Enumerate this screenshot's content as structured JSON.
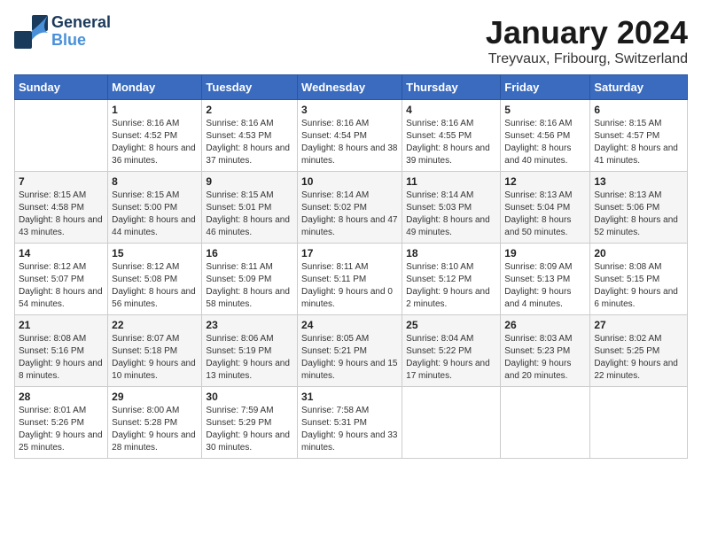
{
  "logo": {
    "general": "General",
    "blue": "Blue",
    "bird_unicode": "🐦"
  },
  "header": {
    "month_year": "January 2024",
    "location": "Treyvaux, Fribourg, Switzerland"
  },
  "weekdays": [
    "Sunday",
    "Monday",
    "Tuesday",
    "Wednesday",
    "Thursday",
    "Friday",
    "Saturday"
  ],
  "weeks": [
    [
      {
        "day": "",
        "sunrise": "",
        "sunset": "",
        "daylight": ""
      },
      {
        "day": "1",
        "sunrise": "Sunrise: 8:16 AM",
        "sunset": "Sunset: 4:52 PM",
        "daylight": "Daylight: 8 hours and 36 minutes."
      },
      {
        "day": "2",
        "sunrise": "Sunrise: 8:16 AM",
        "sunset": "Sunset: 4:53 PM",
        "daylight": "Daylight: 8 hours and 37 minutes."
      },
      {
        "day": "3",
        "sunrise": "Sunrise: 8:16 AM",
        "sunset": "Sunset: 4:54 PM",
        "daylight": "Daylight: 8 hours and 38 minutes."
      },
      {
        "day": "4",
        "sunrise": "Sunrise: 8:16 AM",
        "sunset": "Sunset: 4:55 PM",
        "daylight": "Daylight: 8 hours and 39 minutes."
      },
      {
        "day": "5",
        "sunrise": "Sunrise: 8:16 AM",
        "sunset": "Sunset: 4:56 PM",
        "daylight": "Daylight: 8 hours and 40 minutes."
      },
      {
        "day": "6",
        "sunrise": "Sunrise: 8:15 AM",
        "sunset": "Sunset: 4:57 PM",
        "daylight": "Daylight: 8 hours and 41 minutes."
      }
    ],
    [
      {
        "day": "7",
        "sunrise": "Sunrise: 8:15 AM",
        "sunset": "Sunset: 4:58 PM",
        "daylight": "Daylight: 8 hours and 43 minutes."
      },
      {
        "day": "8",
        "sunrise": "Sunrise: 8:15 AM",
        "sunset": "Sunset: 5:00 PM",
        "daylight": "Daylight: 8 hours and 44 minutes."
      },
      {
        "day": "9",
        "sunrise": "Sunrise: 8:15 AM",
        "sunset": "Sunset: 5:01 PM",
        "daylight": "Daylight: 8 hours and 46 minutes."
      },
      {
        "day": "10",
        "sunrise": "Sunrise: 8:14 AM",
        "sunset": "Sunset: 5:02 PM",
        "daylight": "Daylight: 8 hours and 47 minutes."
      },
      {
        "day": "11",
        "sunrise": "Sunrise: 8:14 AM",
        "sunset": "Sunset: 5:03 PM",
        "daylight": "Daylight: 8 hours and 49 minutes."
      },
      {
        "day": "12",
        "sunrise": "Sunrise: 8:13 AM",
        "sunset": "Sunset: 5:04 PM",
        "daylight": "Daylight: 8 hours and 50 minutes."
      },
      {
        "day": "13",
        "sunrise": "Sunrise: 8:13 AM",
        "sunset": "Sunset: 5:06 PM",
        "daylight": "Daylight: 8 hours and 52 minutes."
      }
    ],
    [
      {
        "day": "14",
        "sunrise": "Sunrise: 8:12 AM",
        "sunset": "Sunset: 5:07 PM",
        "daylight": "Daylight: 8 hours and 54 minutes."
      },
      {
        "day": "15",
        "sunrise": "Sunrise: 8:12 AM",
        "sunset": "Sunset: 5:08 PM",
        "daylight": "Daylight: 8 hours and 56 minutes."
      },
      {
        "day": "16",
        "sunrise": "Sunrise: 8:11 AM",
        "sunset": "Sunset: 5:09 PM",
        "daylight": "Daylight: 8 hours and 58 minutes."
      },
      {
        "day": "17",
        "sunrise": "Sunrise: 8:11 AM",
        "sunset": "Sunset: 5:11 PM",
        "daylight": "Daylight: 9 hours and 0 minutes."
      },
      {
        "day": "18",
        "sunrise": "Sunrise: 8:10 AM",
        "sunset": "Sunset: 5:12 PM",
        "daylight": "Daylight: 9 hours and 2 minutes."
      },
      {
        "day": "19",
        "sunrise": "Sunrise: 8:09 AM",
        "sunset": "Sunset: 5:13 PM",
        "daylight": "Daylight: 9 hours and 4 minutes."
      },
      {
        "day": "20",
        "sunrise": "Sunrise: 8:08 AM",
        "sunset": "Sunset: 5:15 PM",
        "daylight": "Daylight: 9 hours and 6 minutes."
      }
    ],
    [
      {
        "day": "21",
        "sunrise": "Sunrise: 8:08 AM",
        "sunset": "Sunset: 5:16 PM",
        "daylight": "Daylight: 9 hours and 8 minutes."
      },
      {
        "day": "22",
        "sunrise": "Sunrise: 8:07 AM",
        "sunset": "Sunset: 5:18 PM",
        "daylight": "Daylight: 9 hours and 10 minutes."
      },
      {
        "day": "23",
        "sunrise": "Sunrise: 8:06 AM",
        "sunset": "Sunset: 5:19 PM",
        "daylight": "Daylight: 9 hours and 13 minutes."
      },
      {
        "day": "24",
        "sunrise": "Sunrise: 8:05 AM",
        "sunset": "Sunset: 5:21 PM",
        "daylight": "Daylight: 9 hours and 15 minutes."
      },
      {
        "day": "25",
        "sunrise": "Sunrise: 8:04 AM",
        "sunset": "Sunset: 5:22 PM",
        "daylight": "Daylight: 9 hours and 17 minutes."
      },
      {
        "day": "26",
        "sunrise": "Sunrise: 8:03 AM",
        "sunset": "Sunset: 5:23 PM",
        "daylight": "Daylight: 9 hours and 20 minutes."
      },
      {
        "day": "27",
        "sunrise": "Sunrise: 8:02 AM",
        "sunset": "Sunset: 5:25 PM",
        "daylight": "Daylight: 9 hours and 22 minutes."
      }
    ],
    [
      {
        "day": "28",
        "sunrise": "Sunrise: 8:01 AM",
        "sunset": "Sunset: 5:26 PM",
        "daylight": "Daylight: 9 hours and 25 minutes."
      },
      {
        "day": "29",
        "sunrise": "Sunrise: 8:00 AM",
        "sunset": "Sunset: 5:28 PM",
        "daylight": "Daylight: 9 hours and 28 minutes."
      },
      {
        "day": "30",
        "sunrise": "Sunrise: 7:59 AM",
        "sunset": "Sunset: 5:29 PM",
        "daylight": "Daylight: 9 hours and 30 minutes."
      },
      {
        "day": "31",
        "sunrise": "Sunrise: 7:58 AM",
        "sunset": "Sunset: 5:31 PM",
        "daylight": "Daylight: 9 hours and 33 minutes."
      },
      {
        "day": "",
        "sunrise": "",
        "sunset": "",
        "daylight": ""
      },
      {
        "day": "",
        "sunrise": "",
        "sunset": "",
        "daylight": ""
      },
      {
        "day": "",
        "sunrise": "",
        "sunset": "",
        "daylight": ""
      }
    ]
  ]
}
